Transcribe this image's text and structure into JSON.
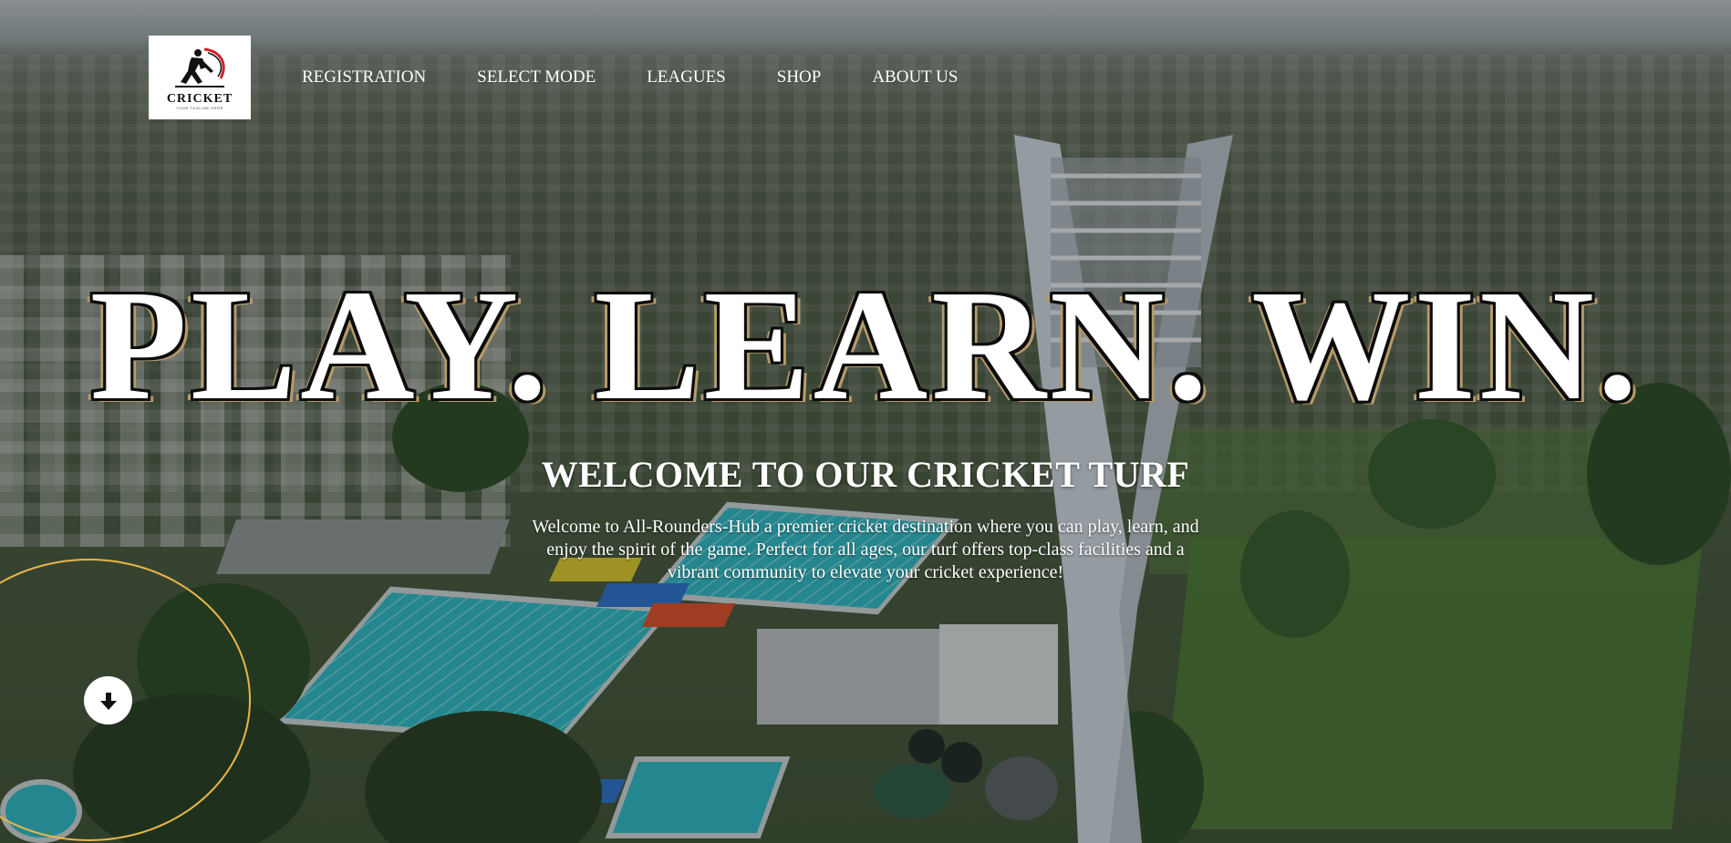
{
  "brand": {
    "name": "CRICKET",
    "tagline": "YOUR TAGLINE HERE"
  },
  "nav": {
    "items": [
      {
        "label": "REGISTRATION"
      },
      {
        "label": "SELECT MODE"
      },
      {
        "label": "LEAGUES"
      },
      {
        "label": "SHOP"
      },
      {
        "label": "ABOUT US"
      }
    ]
  },
  "hero": {
    "headline": "PLAY. LEARN. WIN.",
    "title": "WELCOME TO OUR CRICKET TURF",
    "description": "Welcome to All-Rounders-Hub a premier cricket destination where you can play, learn, and enjoy the spirit of the game. Perfect for all ages, our turf offers top-class facilities and a vibrant community to elevate your cricket experience!"
  },
  "icons": {
    "logo": "batsman-logo-icon",
    "scroll": "arrow-down-icon"
  },
  "colors": {
    "accent_ring": "#e8b54a",
    "headline_outline": "#0d0d0d",
    "headline_shadow": "#b59a6a",
    "logo_swoosh": "#d2202a"
  }
}
